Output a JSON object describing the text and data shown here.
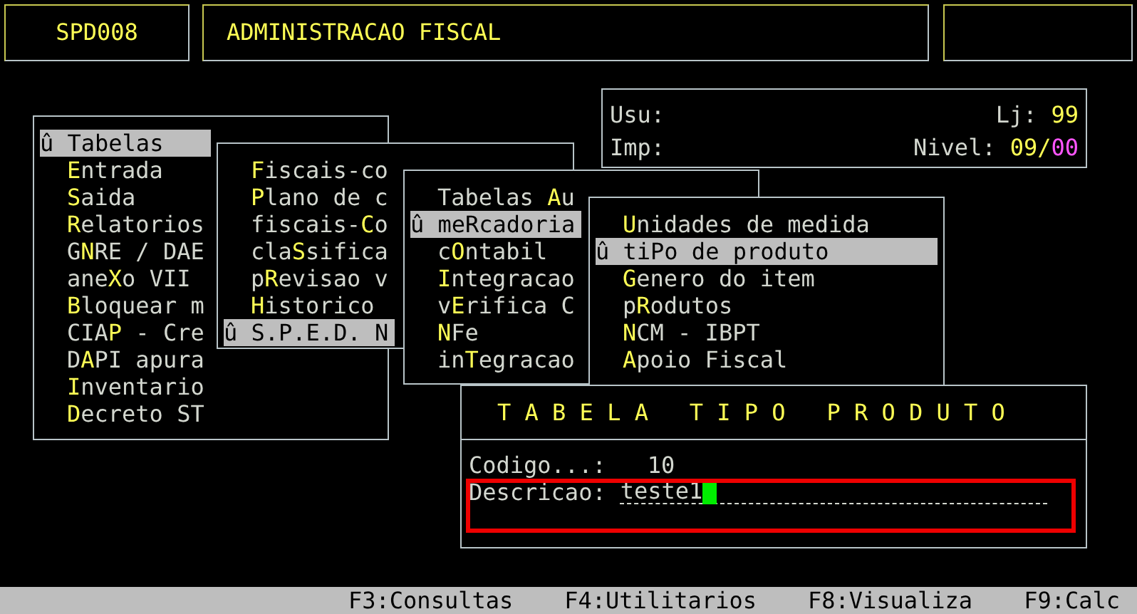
{
  "header": {
    "program_code": "SPD008",
    "module_title": "ADMINISTRACAO FISCAL"
  },
  "info": {
    "user_label": "Usu:",
    "printer_label": "Imp:",
    "store_label": "Lj:",
    "store_value": "99",
    "level_label": "Nivel:",
    "level_value": "09/**00**"
  },
  "menus": [
    {
      "items": [
        {
          "text": "û Tabelas",
          "selected": true
        },
        {
          "text": "**E**ntrada",
          "selected": false
        },
        {
          "text": "**S**aida",
          "selected": false
        },
        {
          "text": "**R**elatorios",
          "selected": false
        },
        {
          "text": "G**N**RE / DAE",
          "selected": false
        },
        {
          "text": "ane**X**o VII",
          "selected": false
        },
        {
          "text": "**B**loquear m",
          "selected": false
        },
        {
          "text": "CIA**P** - Cre",
          "selected": false
        },
        {
          "text": "D**A**PI apura",
          "selected": false
        },
        {
          "text": "**I**nventario",
          "selected": false
        },
        {
          "text": "**D**ecreto ST",
          "selected": false
        }
      ]
    },
    {
      "items": [
        {
          "text": "**F**iscais-co",
          "selected": false
        },
        {
          "text": "**P**lano de c",
          "selected": false
        },
        {
          "text": "fiscais-**C**o",
          "selected": false
        },
        {
          "text": "cla**S**sifica",
          "selected": false
        },
        {
          "text": "p**R**evisao v",
          "selected": false
        },
        {
          "text": "**H**istorico",
          "selected": false
        },
        {
          "text": "û S.P.E.D. N",
          "selected": true
        }
      ]
    },
    {
      "items": [
        {
          "text": "Tabelas **A**u",
          "selected": false
        },
        {
          "text": "û meRcadoria",
          "selected": true
        },
        {
          "text": "c**O**ntabil",
          "selected": false
        },
        {
          "text": "**I**ntegracao",
          "selected": false
        },
        {
          "text": "v**E**rifica C",
          "selected": false
        },
        {
          "text": "**N**Fe",
          "selected": false
        },
        {
          "text": "in**T**egracao",
          "selected": false
        }
      ]
    },
    {
      "items": [
        {
          "text": "**U**nidades de medida",
          "selected": false
        },
        {
          "text": "û tiPo de produto",
          "selected": true
        },
        {
          "text": "**G**enero do item",
          "selected": false
        },
        {
          "text": "p**R**odutos",
          "selected": false
        },
        {
          "text": "**N**CM - IBPT",
          "selected": false
        },
        {
          "text": "**A**poio Fiscal",
          "selected": false
        }
      ]
    }
  ],
  "dialog": {
    "title": "T A B E L A   T I P O   P R O D U T O",
    "fields": [
      {
        "label": "Codigo...:",
        "value": "10",
        "focused": false
      },
      {
        "label": "Descricao:",
        "value": "teste1",
        "focused": true
      }
    ]
  },
  "status_bar": [
    {
      "text": "F3:Consultas"
    },
    {
      "text": "F4:Utilitarios"
    },
    {
      "text": "F8:Visualiza"
    },
    {
      "text": "F9:Calc"
    }
  ]
}
